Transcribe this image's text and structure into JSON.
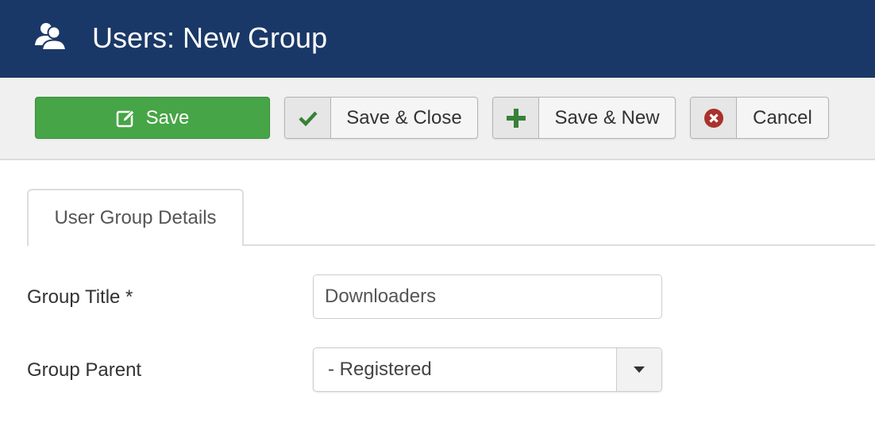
{
  "header": {
    "icon": "users-icon",
    "title": "Users: New Group",
    "background": "#1a3867"
  },
  "toolbar": {
    "buttons": [
      {
        "label": "Save",
        "icon": "edit-icon",
        "style": "primary",
        "color": "#46a546"
      },
      {
        "label": "Save & Close",
        "icon": "check-icon",
        "icon_color": "#378137"
      },
      {
        "label": "Save & New",
        "icon": "plus-icon",
        "icon_color": "#378137"
      },
      {
        "label": "Cancel",
        "icon": "cancel-circle-icon",
        "icon_color": "#a9322b"
      }
    ]
  },
  "tabs": [
    {
      "label": "User Group Details",
      "active": true
    }
  ],
  "form": {
    "fields": [
      {
        "label": "Group Title *",
        "type": "text",
        "value": "Downloaders"
      },
      {
        "label": "Group Parent",
        "type": "select",
        "value": "- Registered",
        "icon": "caret-down-icon"
      }
    ]
  }
}
